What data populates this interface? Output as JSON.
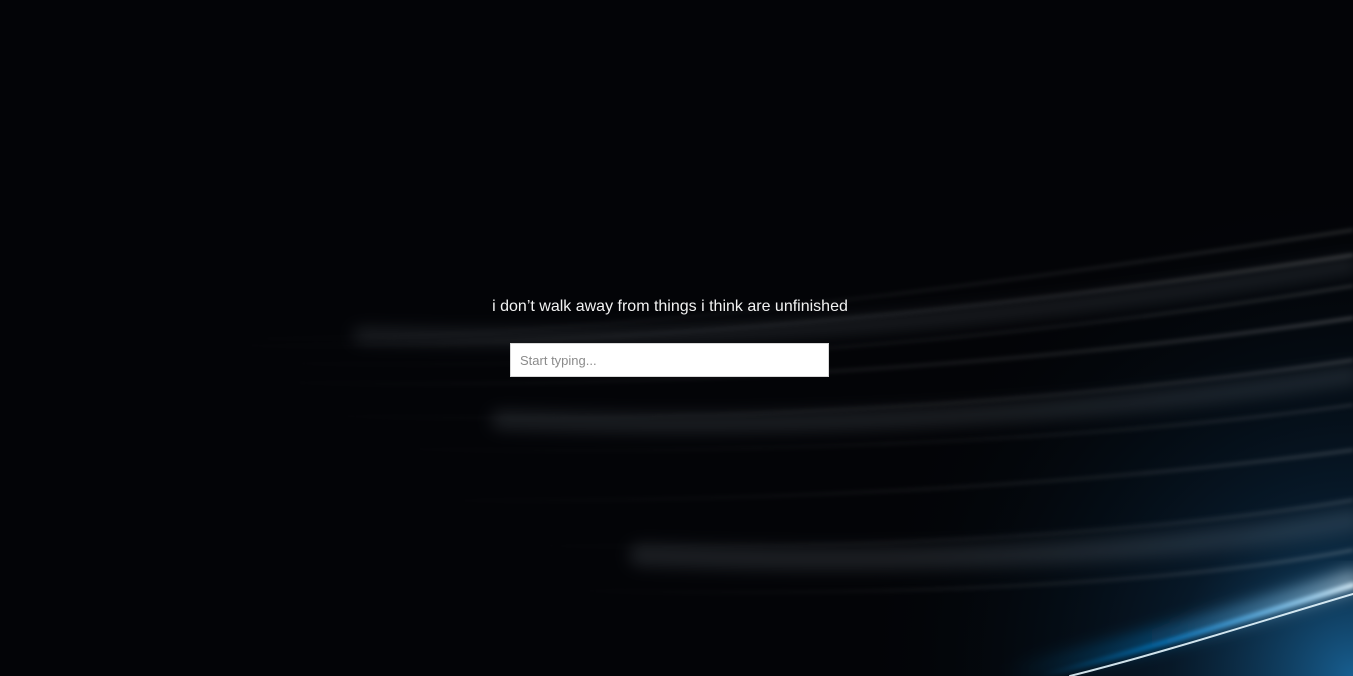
{
  "hero": {
    "quote": "i don’t walk away from things i think are unfinished"
  },
  "search": {
    "placeholder": "Start typing...",
    "value": ""
  },
  "background": {
    "base_color": "#030407",
    "streak_color": "#d9e7f5",
    "glow_color": "#148bff"
  }
}
